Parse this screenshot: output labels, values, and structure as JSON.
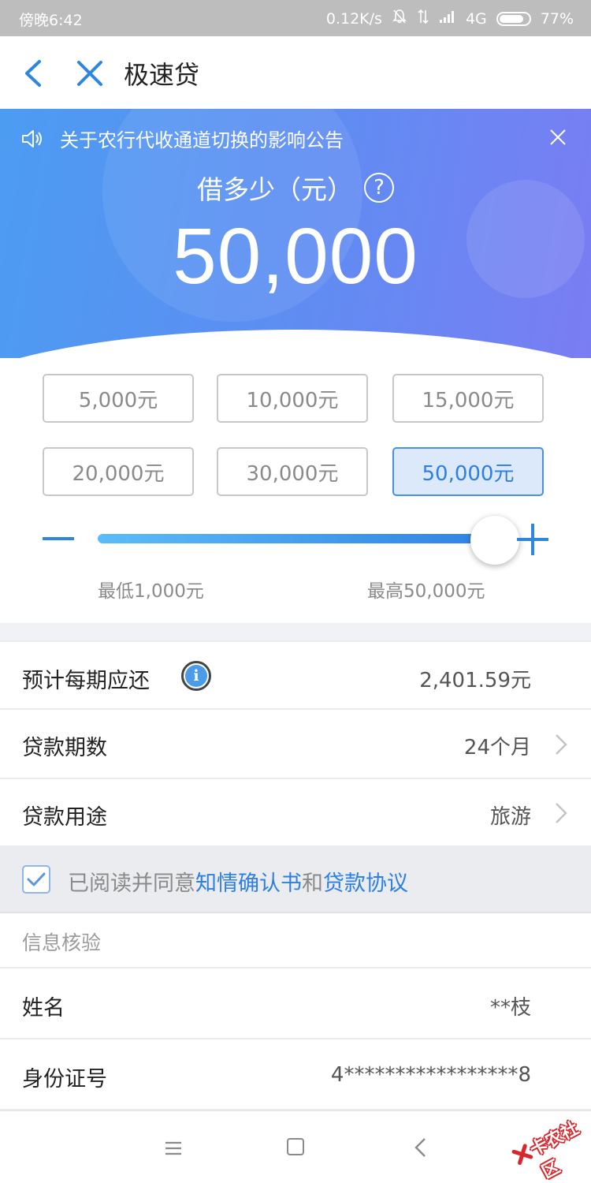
{
  "status_bar": {
    "time": "傍晚6:42",
    "speed": "0.12K/s",
    "network": "4G",
    "battery": "77%"
  },
  "nav": {
    "title": "极速贷"
  },
  "notice": {
    "text": "关于农行代收通道切换的影响公告"
  },
  "borrow": {
    "label": "借多少（元）",
    "help_glyph": "?",
    "amount": "50,000"
  },
  "amount_options": [
    {
      "label": "5,000元",
      "selected": false
    },
    {
      "label": "10,000元",
      "selected": false
    },
    {
      "label": "15,000元",
      "selected": false
    },
    {
      "label": "20,000元",
      "selected": false
    },
    {
      "label": "30,000元",
      "selected": false
    },
    {
      "label": "50,000元",
      "selected": true
    }
  ],
  "slider": {
    "min_label": "最低1,000元",
    "max_label": "最高50,000元",
    "fraction": 1.0
  },
  "summary": {
    "installment_label": "预计每期应还",
    "installment_value": "2,401.59元",
    "term_label": "贷款期数",
    "term_value": "24个月",
    "purpose_label": "贷款用途",
    "purpose_value": "旅游"
  },
  "agreement": {
    "prefix": "已阅读并同意",
    "link1": "知情确认书",
    "middle": "和",
    "link2": "贷款协议",
    "checked": true
  },
  "verification": {
    "section_title": "信息核验",
    "name_label": "姓名",
    "name_value": "**枝",
    "id_label": "身份证号",
    "id_value": "4*****************8"
  },
  "watermark": {
    "text": "卡农社区"
  },
  "colors": {
    "accent": "#2d7fe0",
    "hero_start": "#4c9cf2",
    "hero_end": "#7a7df2"
  }
}
